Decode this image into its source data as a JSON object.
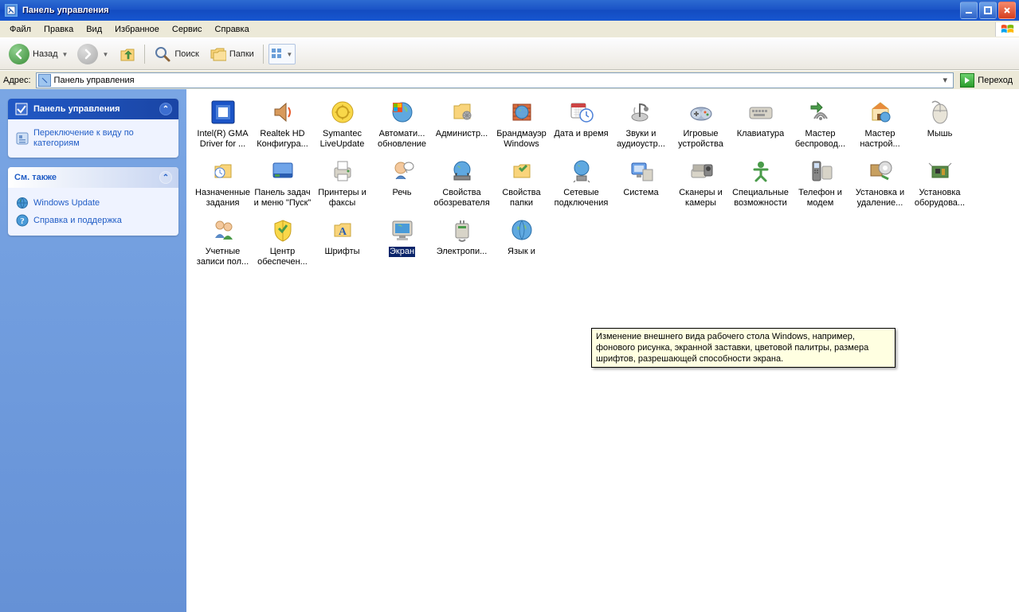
{
  "window": {
    "title": "Панель управления"
  },
  "menu": {
    "file": "Файл",
    "edit": "Правка",
    "view": "Вид",
    "favorites": "Избранное",
    "tools": "Сервис",
    "help": "Справка"
  },
  "toolbar": {
    "back": "Назад",
    "search": "Поиск",
    "folders": "Папки"
  },
  "address": {
    "label": "Адрес:",
    "value": "Панель управления",
    "go": "Переход"
  },
  "side": {
    "panel1": {
      "title": "Панель управления",
      "link1": "Переключение к виду по категориям"
    },
    "panel2": {
      "title": "См. также",
      "link1": "Windows Update",
      "link2": "Справка и поддержка"
    }
  },
  "tooltip": "Изменение внешнего вида рабочего стола Windows, например, фонового рисунка, экранной заставки, цветовой палитры, размера шрифтов, разрешающей способности экрана.",
  "items": [
    {
      "l1": "Intel(R) GMA",
      "l2": "Driver for ...",
      "ic": "intel"
    },
    {
      "l1": "Realtek HD",
      "l2": "Конфигура...",
      "ic": "speaker"
    },
    {
      "l1": "Symantec",
      "l2": "LiveUpdate",
      "ic": "update"
    },
    {
      "l1": "Автомати...",
      "l2": "обновление",
      "ic": "globe"
    },
    {
      "l1": "Администр...",
      "l2": "",
      "ic": "admin"
    },
    {
      "l1": "Брандмауэр",
      "l2": "Windows",
      "ic": "firewall"
    },
    {
      "l1": "Дата и время",
      "l2": "",
      "ic": "datetime"
    },
    {
      "l1": "Звуки и",
      "l2": "аудиоустр...",
      "ic": "sound"
    },
    {
      "l1": "Игровые",
      "l2": "устройства",
      "ic": "game"
    },
    {
      "l1": "Клавиатура",
      "l2": "",
      "ic": "keyboard"
    },
    {
      "l1": "Мастер",
      "l2": "беспровод...",
      "ic": "wireless"
    },
    {
      "l1": "Мастер",
      "l2": "настрой...",
      "ic": "netwiz"
    },
    {
      "l1": "Мышь",
      "l2": "",
      "ic": "mouse"
    },
    {
      "l1": "Назначенные",
      "l2": "задания",
      "ic": "tasks"
    },
    {
      "l1": "Панель задач",
      "l2": "и меню \"Пуск\"",
      "ic": "taskbar"
    },
    {
      "l1": "Принтеры и",
      "l2": "факсы",
      "ic": "printer"
    },
    {
      "l1": "Речь",
      "l2": "",
      "ic": "speech"
    },
    {
      "l1": "Свойства",
      "l2": "обозревателя",
      "ic": "inetopt"
    },
    {
      "l1": "Свойства",
      "l2": "папки",
      "ic": "folderopt"
    },
    {
      "l1": "Сетевые",
      "l2": "подключения",
      "ic": "netconn"
    },
    {
      "l1": "Система",
      "l2": "",
      "ic": "system"
    },
    {
      "l1": "Сканеры и",
      "l2": "камеры",
      "ic": "scanner"
    },
    {
      "l1": "Специальные",
      "l2": "возможности",
      "ic": "access"
    },
    {
      "l1": "Телефон и",
      "l2": "модем",
      "ic": "phone"
    },
    {
      "l1": "Установка и",
      "l2": "удаление...",
      "ic": "addremove"
    },
    {
      "l1": "Установка",
      "l2": "оборудова...",
      "ic": "hardware"
    },
    {
      "l1": "Учетные",
      "l2": "записи пол...",
      "ic": "users"
    },
    {
      "l1": "Центр",
      "l2": "обеспечен...",
      "ic": "security"
    },
    {
      "l1": "Шрифты",
      "l2": "",
      "ic": "fonts"
    },
    {
      "l1": "Экран",
      "l2": "",
      "ic": "display",
      "selected": true
    },
    {
      "l1": "Электропи...",
      "l2": "",
      "ic": "power"
    },
    {
      "l1": "Язык и",
      "l2": "",
      "ic": "region"
    }
  ]
}
